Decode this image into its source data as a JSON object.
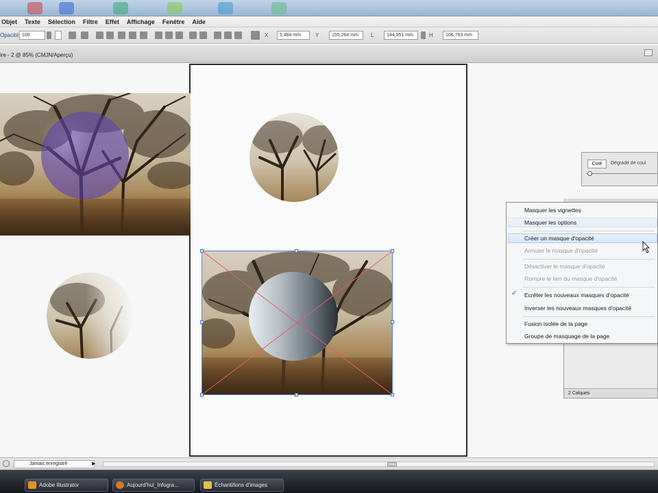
{
  "menubar": {
    "items": [
      "Objet",
      "Texte",
      "Sélection",
      "Filtre",
      "Effet",
      "Affichage",
      "Fenêtre",
      "Aide"
    ]
  },
  "controlbar": {
    "opacity_label": "Opacité :",
    "opacity_value": "100",
    "x_label": "X",
    "x_value": "5,484 mm",
    "y_label": "Y",
    "y_value": "155,264 mm",
    "w_label": "L",
    "w_value": "144,951 mm",
    "h_label": "H",
    "h_value": "106,763 mm"
  },
  "document": {
    "tab_title": "ire - 2 @ 85% (CMJN/Aperçu)"
  },
  "transparency_panel": {
    "mode": "Coté",
    "gradient_label": "Dégradé de coul"
  },
  "context_menu": {
    "items": [
      {
        "label": "Masquer les vignettes",
        "enabled": true,
        "checked": false
      },
      {
        "label": "Masquer les options",
        "enabled": true,
        "checked": false,
        "highlight": true
      },
      {
        "label": "Créer un masque d'opacité",
        "enabled": true,
        "checked": false,
        "highlight": true
      },
      {
        "label": "Annuler le masque d'opacité",
        "enabled": false,
        "checked": false
      },
      {
        "label": "Désactiver le masque d'opacité",
        "enabled": false,
        "checked": false
      },
      {
        "label": "Rompre le lien du masque d'opacité",
        "enabled": false,
        "checked": false
      },
      {
        "label": "Ecrêter les nouveaux masques d'opacité",
        "enabled": true,
        "checked": true
      },
      {
        "label": "Inverser les nouveaux masques d'opacité",
        "enabled": true,
        "checked": false
      },
      {
        "label": "Fusion isolée de la page",
        "enabled": true,
        "checked": false
      },
      {
        "label": "Groupe de masquage de la page",
        "enabled": true,
        "checked": false
      }
    ]
  },
  "layers_panel": {
    "footer": "2 Calques"
  },
  "statusbar": {
    "status": "Jamais enregistré"
  },
  "taskbar": {
    "tasks": [
      "Adobe Illustrator",
      "Aujourd'hui_Infogra...",
      "Échantillons d'images"
    ]
  }
}
